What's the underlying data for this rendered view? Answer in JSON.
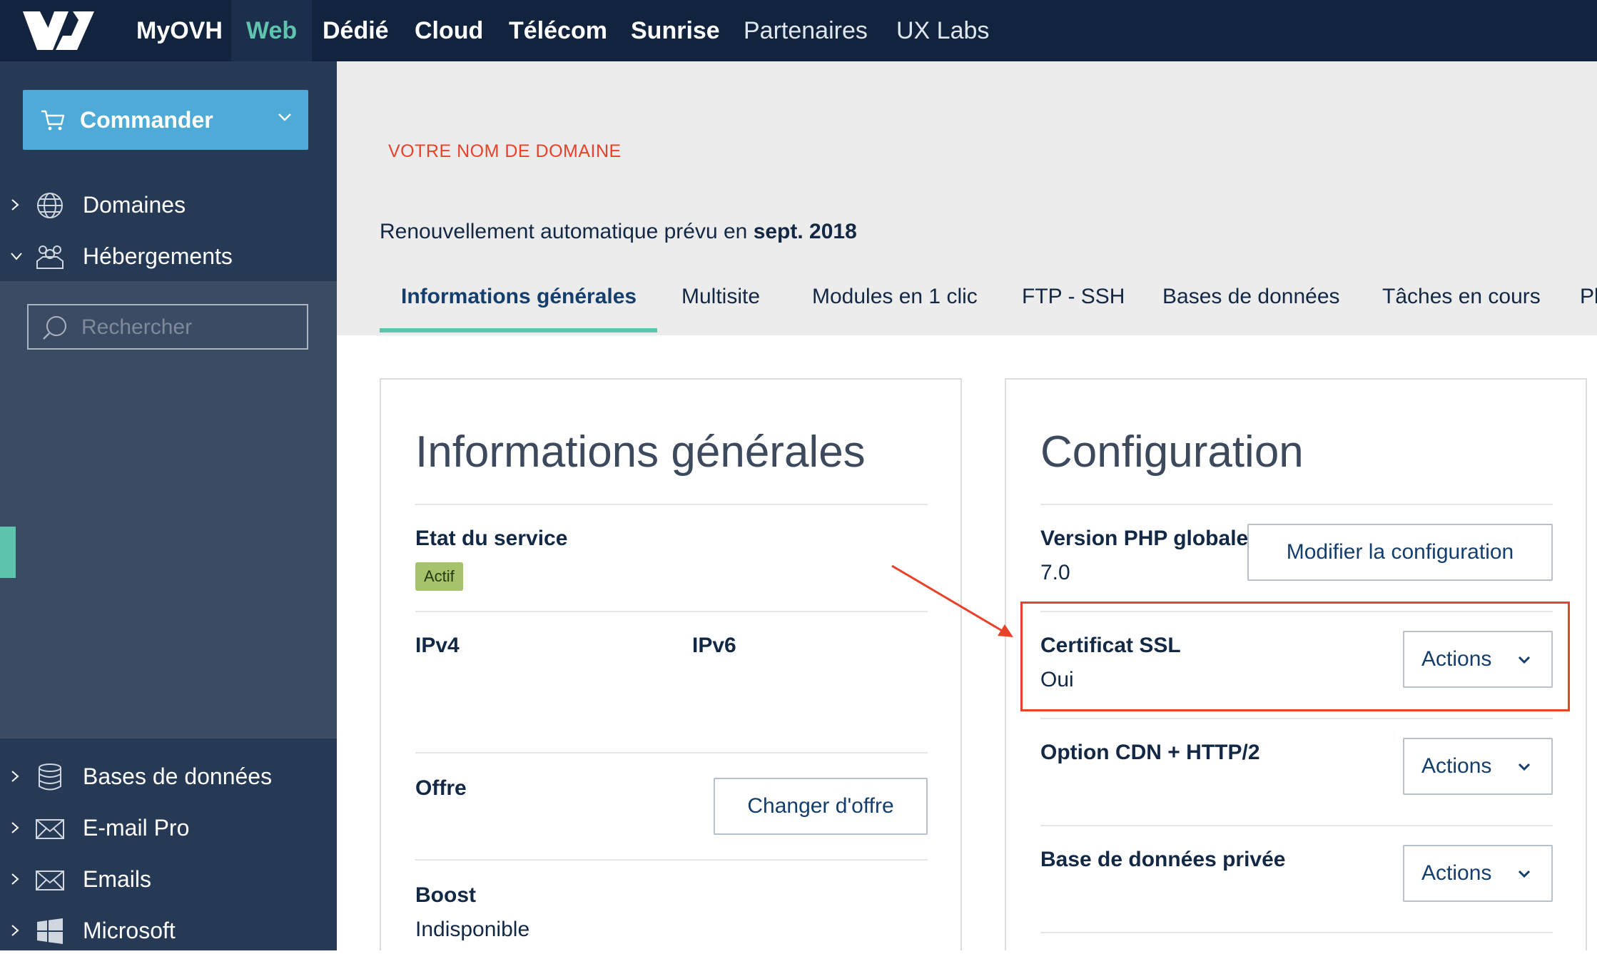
{
  "topnav": {
    "logo": "ovh-logo",
    "items": [
      {
        "label": "MyOVH",
        "active": false
      },
      {
        "label": "Web",
        "active": true
      },
      {
        "label": "Dédié",
        "active": false
      },
      {
        "label": "Cloud",
        "active": false
      },
      {
        "label": "Télécom",
        "active": false
      },
      {
        "label": "Sunrise",
        "active": false
      },
      {
        "label": "Partenaires",
        "active": false
      },
      {
        "label": "UX Labs",
        "active": false
      }
    ]
  },
  "sidebar": {
    "order_button": {
      "label": "Commander",
      "icon": "cart-icon"
    },
    "top_items": [
      {
        "label": "Domaines",
        "icon": "globe-icon",
        "expanded": false
      },
      {
        "label": "Hébergements",
        "icon": "users-icon",
        "expanded": true
      }
    ],
    "search": {
      "placeholder": "Rechercher",
      "value": ""
    },
    "bottom_items": [
      {
        "label": "Bases de données",
        "icon": "database-icon"
      },
      {
        "label": "E-mail Pro",
        "icon": "mail-icon"
      },
      {
        "label": "Emails",
        "icon": "mail-icon"
      },
      {
        "label": "Microsoft",
        "icon": "windows-icon"
      }
    ]
  },
  "header": {
    "domain_name": "VOTRE NOM DE DOMAINE",
    "renewal_text": "Renouvellement automatique prévu en",
    "renewal_date": "sept. 2018",
    "tabs": [
      {
        "label": "Informations générales",
        "active": true
      },
      {
        "label": "Multisite"
      },
      {
        "label": "Modules en 1 clic"
      },
      {
        "label": "FTP - SSH"
      },
      {
        "label": "Bases de données"
      },
      {
        "label": "Tâches en cours"
      },
      {
        "label": "Pl"
      }
    ]
  },
  "general_card": {
    "title": "Informations générales",
    "service_state_label": "Etat du service",
    "service_state_value": "Actif",
    "ipv4_label": "IPv4",
    "ipv6_label": "IPv6",
    "offer_label": "Offre",
    "offer_button": "Changer d'offre",
    "boost_label": "Boost",
    "boost_value": "Indisponible"
  },
  "config_card": {
    "title": "Configuration",
    "php_label": "Version PHP globale",
    "php_value": "7.0",
    "php_button": "Modifier la configuration",
    "ssl_label": "Certificat SSL",
    "ssl_value": "Oui",
    "ssl_button": "Actions",
    "cdn_label": "Option CDN + HTTP/2",
    "cdn_button": "Actions",
    "privdb_label": "Base de données privée",
    "privdb_button": "Actions"
  },
  "colors": {
    "topbar": "#12233e",
    "sidebar": "#3b4b63",
    "accent": "#5ec4ad",
    "order_button": "#4eaad6",
    "annotation": "#e8432a",
    "badge": "#a6c26a"
  }
}
